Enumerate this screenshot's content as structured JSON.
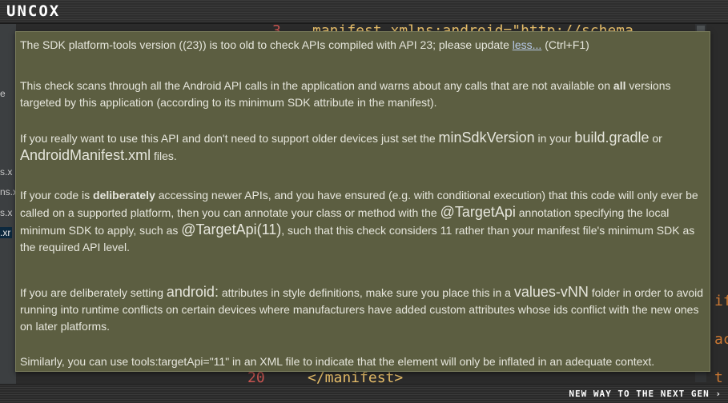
{
  "app": {
    "logo": "UNCOX"
  },
  "footer": {
    "tagline": "NEW WAY TO THE NEXT GEN ›"
  },
  "sidebar": {
    "fragments": [
      {
        "text": "e"
      },
      {
        "text": "s.x"
      },
      {
        "text": "ns.x"
      },
      {
        "text": "s.x"
      },
      {
        "text": ".xr"
      }
    ]
  },
  "editor": {
    "top_line_number": "3",
    "top_code": "manifest xmlns:android=\"http://schema",
    "bottom_line_number": "20",
    "bottom_code": "</manifest>",
    "right_fragments": [
      "if",
      "ac",
      "t"
    ]
  },
  "tooltip": {
    "line1_text": "The SDK platform-tools version ((23)) is too old to check APIs compiled with API 23; please update ",
    "line1_link": "less...",
    "line1_shortcut": " (Ctrl+F1)",
    "p2_a": "This check scans through all the Android API calls in the application and warns about any calls that are not available on ",
    "p2_bold": "all",
    "p2_b": " versions targeted by this application (according to its minimum SDK attribute in the manifest).",
    "p3_a": "If you really want to use this API and don't need to support older devices just set the ",
    "p3_code1": "minSdkVersion",
    "p3_b": " in your ",
    "p3_code2": "build.gradle",
    "p3_c": " or ",
    "p3_code3": "AndroidManifest.xml",
    "p3_d": " files.",
    "p4_a": "If your code is ",
    "p4_bold": "deliberately",
    "p4_b": " accessing newer APIs, and you have ensured (e.g. with conditional execution) that this code will only ever be called on a supported platform, then you can annotate your class or method with the ",
    "p4_code1": "@TargetApi",
    "p4_c": " annotation specifying the local minimum SDK to apply, such as ",
    "p4_code2": "@TargetApi(11)",
    "p4_d": ", such that this check considers 11 rather than your manifest file's minimum SDK as the required API level.",
    "p5_a": "If you are deliberately setting ",
    "p5_code1": "android:",
    "p5_b": " attributes in style definitions, make sure you place this in a ",
    "p5_code2": "values-vNN",
    "p5_c": " folder in order to avoid running into runtime conflicts on certain devices where manufacturers have added custom attributes whose ids conflict with the new ones on later platforms.",
    "p6": "Similarly, you can use tools:targetApi=\"11\" in an XML file to indicate that the element will only be inflated in an adequate context."
  }
}
